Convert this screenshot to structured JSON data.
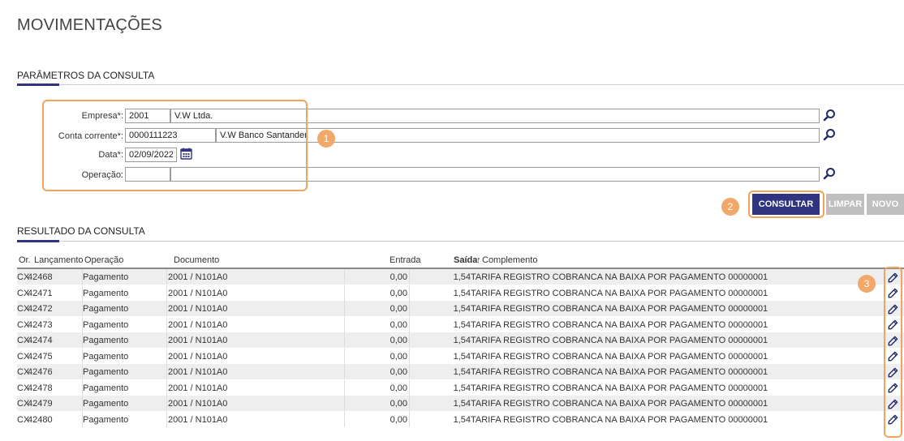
{
  "page": {
    "title": "MOVIMENTAÇÕES"
  },
  "params": {
    "title": "PARÂMETROS DA CONSULTA",
    "empresa": {
      "label": "Empresa*:",
      "code": "2001",
      "name": "V.W Ltda."
    },
    "conta": {
      "label": "Conta corrente*:",
      "code": "0000111223",
      "name": "V.W Banco Santander"
    },
    "data": {
      "label": "Data*:",
      "value": "02/09/2022"
    },
    "operacao": {
      "label": "Operação:",
      "code": "",
      "name": ""
    }
  },
  "callouts": [
    "1",
    "2",
    "3"
  ],
  "buttons": {
    "consultar": "CONSULTAR",
    "limpar": "LIMPAR",
    "novo": "NOVO"
  },
  "results": {
    "title": "RESULTADO DA CONSULTA",
    "columns": {
      "origem": "Or.",
      "lancamento": "Lançamento",
      "operacao": "Operação",
      "documento": "Documento",
      "entrada": "Entrada",
      "saida": "Saída",
      "sort_indicator": "↑",
      "complemento": "Complemento"
    },
    "rows": [
      {
        "or": "CX",
        "lanc": "42468",
        "op": "Pagamento",
        "doc": "2001 / N101A0",
        "entrada": "0,00",
        "saida": "1,54",
        "compl": "TARIFA REGISTRO COBRANCA NA BAIXA POR PAGAMENTO 00000001"
      },
      {
        "or": "CX",
        "lanc": "42471",
        "op": "Pagamento",
        "doc": "2001 / N101A0",
        "entrada": "0,00",
        "saida": "1,54",
        "compl": "TARIFA REGISTRO COBRANCA NA BAIXA POR PAGAMENTO 00000001"
      },
      {
        "or": "CX",
        "lanc": "42472",
        "op": "Pagamento",
        "doc": "2001 / N101A0",
        "entrada": "0,00",
        "saida": "1,54",
        "compl": "TARIFA REGISTRO COBRANCA NA BAIXA POR PAGAMENTO 00000001"
      },
      {
        "or": "CX",
        "lanc": "42473",
        "op": "Pagamento",
        "doc": "2001 / N101A0",
        "entrada": "0,00",
        "saida": "1,54",
        "compl": "TARIFA REGISTRO COBRANCA NA BAIXA POR PAGAMENTO 00000001"
      },
      {
        "or": "CX",
        "lanc": "42474",
        "op": "Pagamento",
        "doc": "2001 / N101A0",
        "entrada": "0,00",
        "saida": "1,54",
        "compl": "TARIFA REGISTRO COBRANCA NA BAIXA POR PAGAMENTO 00000001"
      },
      {
        "or": "CX",
        "lanc": "42475",
        "op": "Pagamento",
        "doc": "2001 / N101A0",
        "entrada": "0,00",
        "saida": "1,54",
        "compl": "TARIFA REGISTRO COBRANCA NA BAIXA POR PAGAMENTO 00000001"
      },
      {
        "or": "CX",
        "lanc": "42476",
        "op": "Pagamento",
        "doc": "2001 / N101A0",
        "entrada": "0,00",
        "saida": "1,54",
        "compl": "TARIFA REGISTRO COBRANCA NA BAIXA POR PAGAMENTO 00000001"
      },
      {
        "or": "CX",
        "lanc": "42478",
        "op": "Pagamento",
        "doc": "2001 / N101A0",
        "entrada": "0,00",
        "saida": "1,54",
        "compl": "TARIFA REGISTRO COBRANCA NA BAIXA POR PAGAMENTO 00000001"
      },
      {
        "or": "CX",
        "lanc": "42479",
        "op": "Pagamento",
        "doc": "2001 / N101A0",
        "entrada": "0,00",
        "saida": "1,54",
        "compl": "TARIFA REGISTRO COBRANCA NA BAIXA POR PAGAMENTO 00000001"
      },
      {
        "or": "CX",
        "lanc": "42480",
        "op": "Pagamento",
        "doc": "2001 / N101A0",
        "entrada": "0,00",
        "saida": "1,54",
        "compl": "TARIFA REGISTRO COBRANCA NA BAIXA POR PAGAMENTO 00000001"
      }
    ]
  },
  "icons": {
    "search": "search-icon",
    "calendar": "calendar-icon",
    "edit": "pencil-icon"
  },
  "colors": {
    "primary": "#2f3380",
    "highlight": "#f0a460",
    "callout": "#f1a868",
    "search_icon": "#1f2a6b",
    "disabled_button": "#bfbfbf"
  }
}
